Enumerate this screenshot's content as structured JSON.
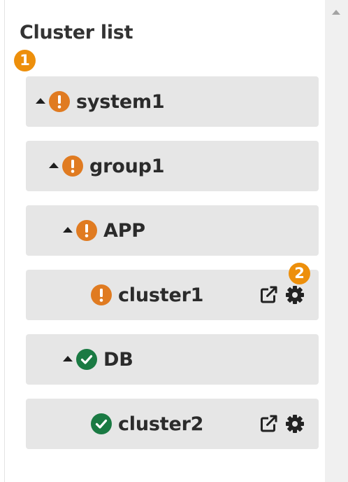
{
  "panel": {
    "title": "Cluster list"
  },
  "callouts": [
    {
      "label": "1"
    },
    {
      "label": "2"
    }
  ],
  "tree": [
    {
      "label": "system1",
      "status": "warning",
      "expanded": true
    },
    {
      "label": "group1",
      "status": "warning",
      "expanded": true
    },
    {
      "label": "APP",
      "status": "warning",
      "expanded": true
    },
    {
      "label": "cluster1",
      "status": "warning",
      "actions": [
        "external-link-icon",
        "gear-icon"
      ]
    },
    {
      "label": "DB",
      "status": "ok",
      "expanded": true
    },
    {
      "label": "cluster2",
      "status": "ok",
      "actions": [
        "external-link-icon",
        "gear-icon"
      ]
    }
  ],
  "colors": {
    "warning": "#e07b21",
    "ok": "#1a7a43",
    "callout": "#ed8f0b",
    "row_background": "#e6e6e6"
  }
}
